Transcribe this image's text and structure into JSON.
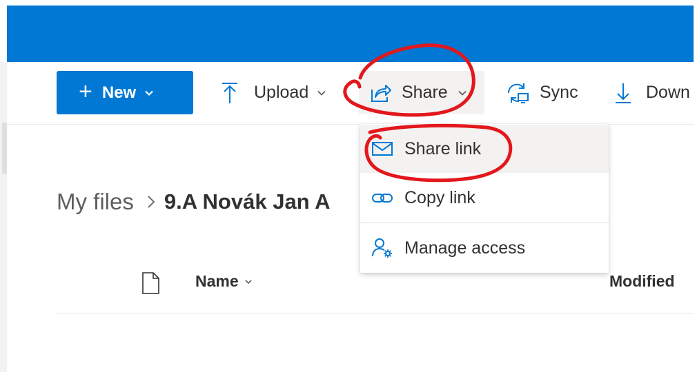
{
  "colors": {
    "brand": "#0078d4",
    "annotation": "#e3171c",
    "text": "#323130",
    "muted": "#605e5c"
  },
  "toolbar": {
    "new_label": "New",
    "upload_label": "Upload",
    "share_label": "Share",
    "sync_label": "Sync",
    "download_label": "Down"
  },
  "share_menu": {
    "items": [
      {
        "label": "Share link",
        "icon": "mail-icon"
      },
      {
        "label": "Copy link",
        "icon": "link-icon"
      },
      {
        "label": "Manage access",
        "icon": "people-settings-icon"
      }
    ]
  },
  "breadcrumb": {
    "root": "My files",
    "current": "9.A Novák Jan A"
  },
  "list": {
    "columns": {
      "name": "Name",
      "modified": "Modified"
    }
  }
}
